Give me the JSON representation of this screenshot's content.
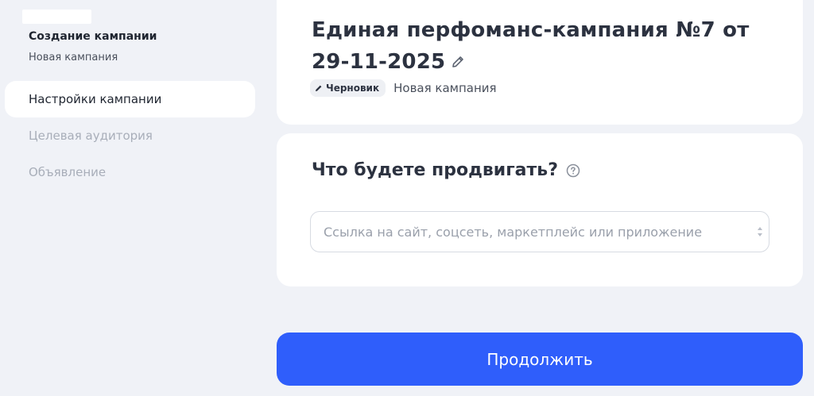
{
  "sidebar": {
    "title": "Создание кампании",
    "subtitle": "Новая кампания",
    "items": [
      {
        "label": "Настройки кампании",
        "state": "active"
      },
      {
        "label": "Целевая аудитория",
        "state": "disabled"
      },
      {
        "label": "Объявление",
        "state": "disabled"
      }
    ]
  },
  "campaign": {
    "title": "Единая перфоманс-кампания №7 от 29-11-2025",
    "status_badge": "Черновик",
    "status_sub": "Новая кампания"
  },
  "promo": {
    "title": "Что будете продвигать?",
    "url_value": "",
    "url_placeholder": "Ссылка на сайт, соцсеть, маркетплейс или приложение"
  },
  "actions": {
    "continue_label": "Продолжить"
  },
  "colors": {
    "background": "#f0f2f7",
    "primary_button": "#2f5efb",
    "card": "#ffffff"
  },
  "icons": [
    "pencil-icon",
    "help-icon",
    "spinner-up-icon",
    "spinner-down-icon"
  ]
}
